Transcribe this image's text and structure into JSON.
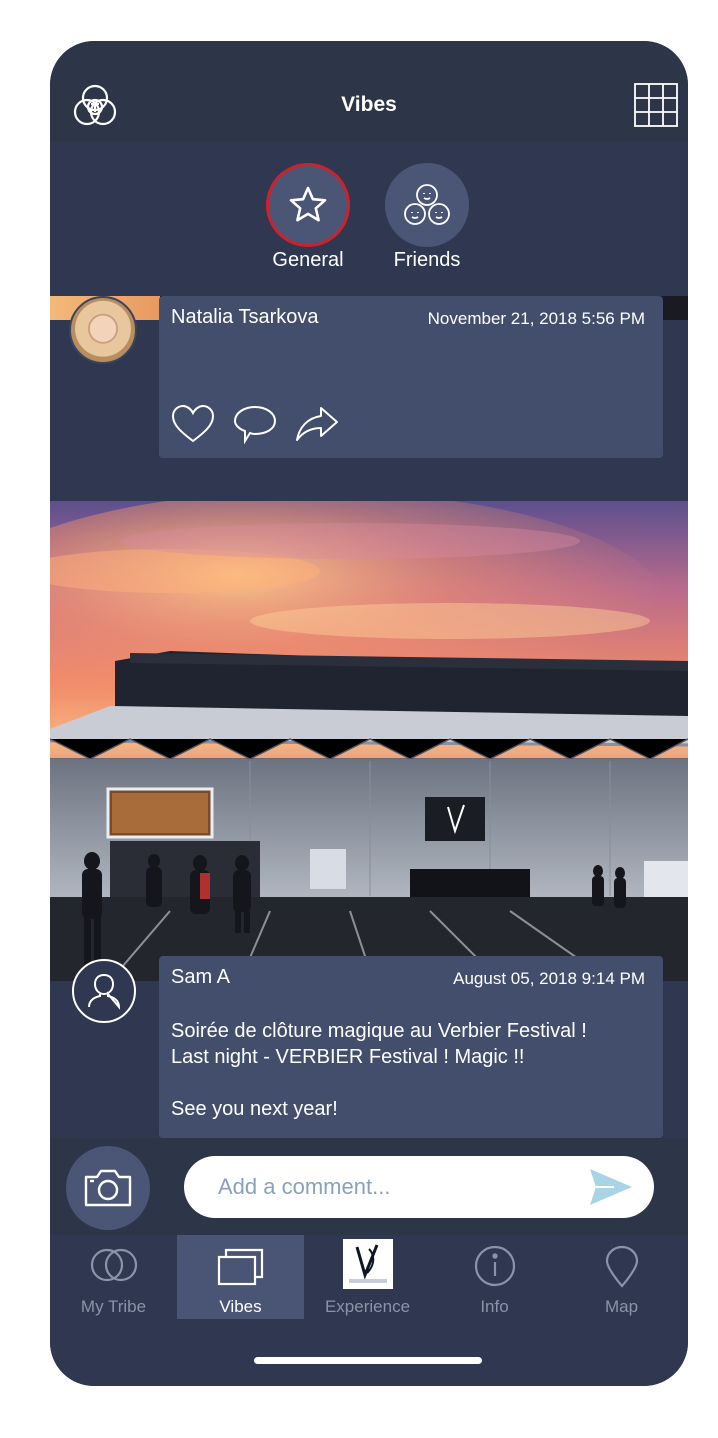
{
  "header": {
    "title": "Vibes",
    "logo_icon": "tribe-logo-icon",
    "grid_icon": "grid-menu-icon"
  },
  "feed_tabs": [
    {
      "label": "General",
      "icon": "star-icon",
      "active": true
    },
    {
      "label": "Friends",
      "icon": "friends-group-icon",
      "active": false
    }
  ],
  "posts": [
    {
      "author": "Natalia Tsarkova",
      "date": "November 21, 2018 5:56 PM",
      "actions": [
        "heart-icon",
        "comment-icon",
        "share-icon"
      ]
    },
    {
      "author": "Sam A",
      "date": "August 05, 2018 9:14 PM",
      "text": "Soirée de clôture magique au Verbier Festival !\nLast night - VERBIER Festival ! Magic !!\n\nSee you next year!"
    }
  ],
  "comment_bar": {
    "placeholder": "Add a comment...",
    "camera_icon": "camera-icon",
    "send_icon": "send-icon"
  },
  "tabbar": {
    "items": [
      {
        "label": "My Tribe",
        "icon": "my-tribe-icon",
        "active": false
      },
      {
        "label": "Vibes",
        "icon": "vibes-icon",
        "active": true
      },
      {
        "label": "Experience",
        "icon": "verbier-festival-logo",
        "active": false
      },
      {
        "label": "Info",
        "icon": "info-icon",
        "active": false
      },
      {
        "label": "Map",
        "icon": "map-pin-icon",
        "active": false
      }
    ]
  },
  "colors": {
    "background": "#2f3850",
    "card": "#434e6d",
    "accent_ring": "#d0202a",
    "send": "#a9d4e6"
  }
}
